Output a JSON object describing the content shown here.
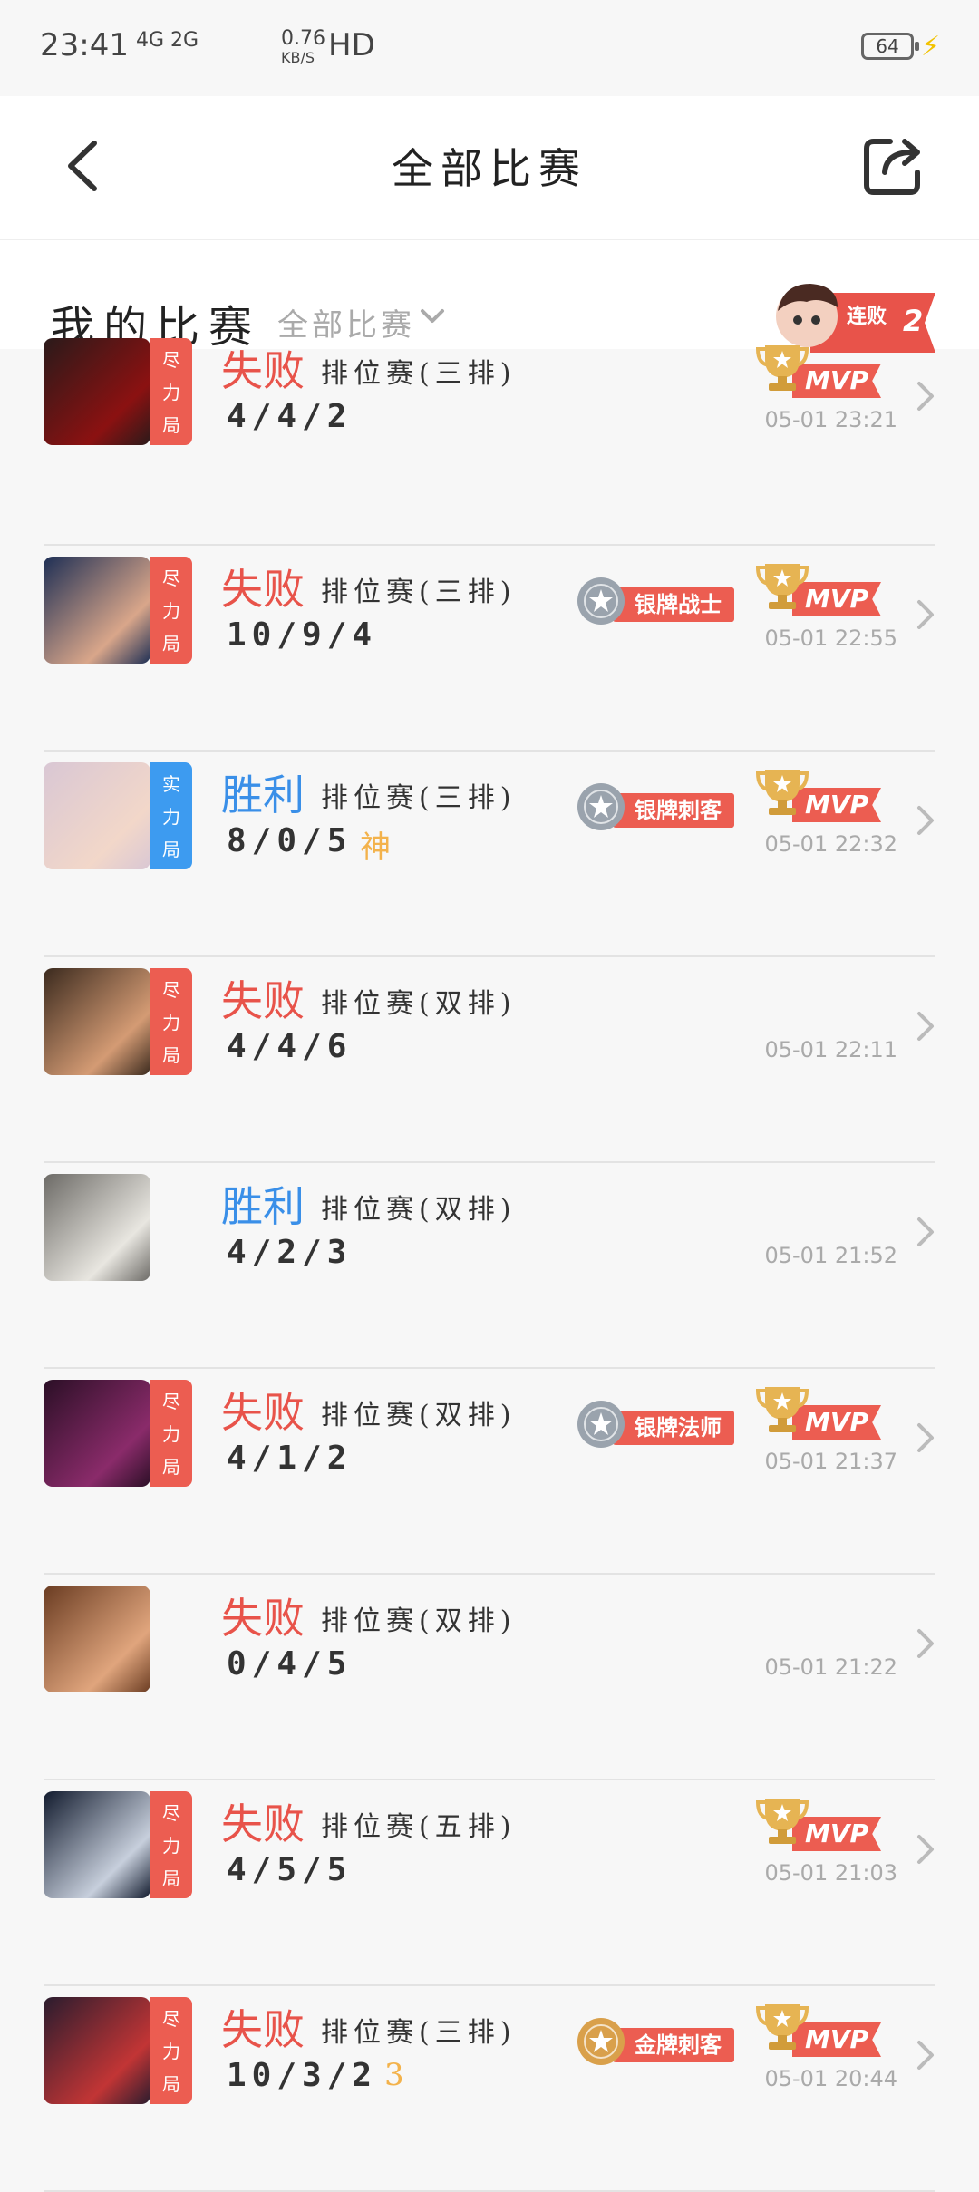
{
  "status": {
    "time": "23:41",
    "signal": "4G 2G",
    "speed_top": "0.76",
    "speed_unit": "KB/S",
    "hd": "HD",
    "battery": "64"
  },
  "header": {
    "title": "全部比赛"
  },
  "subheader": {
    "title": "我的比赛",
    "filter_label": "全部比赛",
    "streak_label": "连败",
    "streak_count": "2"
  },
  "matches": [
    {
      "result": "失败",
      "result_type": "loss",
      "tag": "尽力局",
      "tag_color": "red",
      "mode": "排位赛(三排)",
      "kda": "4/4/2",
      "extra": "",
      "badge": "",
      "mvp": "MVP",
      "time": "05-01 23:21",
      "avatar_colors": [
        "#2a1a1a",
        "#8b1111"
      ]
    },
    {
      "result": "失败",
      "result_type": "loss",
      "tag": "尽力局",
      "tag_color": "red",
      "mode": "排位赛(三排)",
      "kda": "10/9/4",
      "extra": "",
      "badge": "银牌战士",
      "mvp": "MVP",
      "time": "05-01 22:55",
      "avatar_colors": [
        "#1e2f55",
        "#d9a68a"
      ]
    },
    {
      "result": "胜利",
      "result_type": "win",
      "tag": "实力局",
      "tag_color": "blue",
      "mode": "排位赛(三排)",
      "kda": "8/0/5",
      "extra": "神",
      "badge": "银牌刺客",
      "mvp": "MVP",
      "time": "05-01 22:32",
      "avatar_colors": [
        "#d9c7d4",
        "#f2d7c9"
      ]
    },
    {
      "result": "失败",
      "result_type": "loss",
      "tag": "尽力局",
      "tag_color": "red",
      "mode": "排位赛(双排)",
      "kda": "4/4/6",
      "extra": "",
      "badge": "",
      "mvp": "",
      "time": "05-01 22:11",
      "avatar_colors": [
        "#3b2a1e",
        "#d49b74"
      ]
    },
    {
      "result": "胜利",
      "result_type": "win",
      "tag": "",
      "tag_color": "",
      "mode": "排位赛(双排)",
      "kda": "4/2/3",
      "extra": "",
      "badge": "",
      "mvp": "",
      "time": "05-01 21:52",
      "avatar_colors": [
        "#6c6a66",
        "#e8e6e0"
      ]
    },
    {
      "result": "失败",
      "result_type": "loss",
      "tag": "尽力局",
      "tag_color": "red",
      "mode": "排位赛(双排)",
      "kda": "4/1/2",
      "extra": "",
      "badge": "银牌法师",
      "mvp": "MVP",
      "time": "05-01 21:37",
      "avatar_colors": [
        "#2b0f26",
        "#8a2b6a"
      ]
    },
    {
      "result": "失败",
      "result_type": "loss",
      "tag": "",
      "tag_color": "",
      "mode": "排位赛(双排)",
      "kda": "0/4/5",
      "extra": "",
      "badge": "",
      "mvp": "",
      "time": "05-01 21:22",
      "avatar_colors": [
        "#6a3c22",
        "#e0a57d"
      ]
    },
    {
      "result": "失败",
      "result_type": "loss",
      "tag": "尽力局",
      "tag_color": "red",
      "mode": "排位赛(五排)",
      "kda": "4/5/5",
      "extra": "",
      "badge": "",
      "mvp": "MVP",
      "time": "05-01 21:03",
      "avatar_colors": [
        "#121b2e",
        "#c7cfdc"
      ]
    },
    {
      "result": "失败",
      "result_type": "loss",
      "tag": "尽力局",
      "tag_color": "red",
      "mode": "排位赛(三排)",
      "kda": "10/3/2",
      "extra": "3",
      "badge": "金牌刺客",
      "mvp": "MVP",
      "time": "05-01 20:44",
      "avatar_colors": [
        "#2a1c2e",
        "#c23535"
      ]
    }
  ],
  "colors": {
    "loss": "#e8534a",
    "win": "#3a8fe8",
    "silver_badge": "#9aa3ad",
    "gold_badge": "#d9a04b",
    "ribbon": "#ec5d51"
  }
}
